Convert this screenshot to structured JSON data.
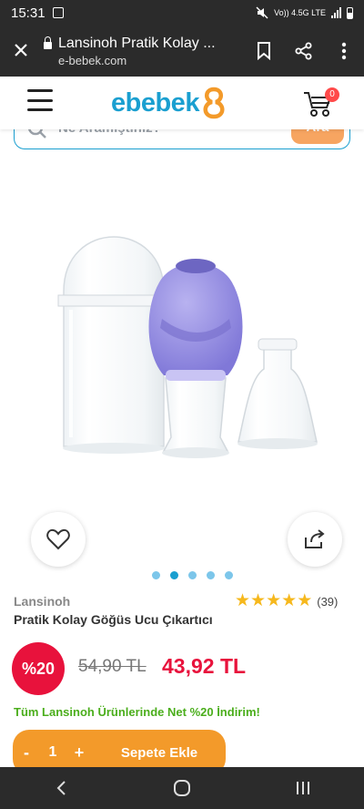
{
  "status_bar": {
    "time": "15:31",
    "network": "Vo)) 4.5G LTE"
  },
  "browser": {
    "tab_title": "Lansinoh Pratik Kolay ...",
    "domain": "e-bebek.com"
  },
  "site": {
    "logo_text": "ebebek",
    "cart_count": "0"
  },
  "search": {
    "placeholder": "Ne Aramıştınız?",
    "button": "Ara"
  },
  "product": {
    "brand": "Lansinoh",
    "name": "Pratik Kolay Göğüs Ucu Çıkartıcı",
    "rating_stars": 5,
    "rating_count": "(39)",
    "discount": "%20",
    "old_price": "54,90 TL",
    "new_price": "43,92 TL",
    "promo": "Tüm Lansinoh Ürünlerinde Net %20 İndirim!",
    "images_total": 5,
    "image_active_index": 2
  },
  "cart_bar": {
    "minus": "-",
    "quantity": "1",
    "plus": "+",
    "add_label": "Sepete Ekle"
  },
  "colors": {
    "brand_blue": "#1a9fd0",
    "accent_orange": "#f39a2a",
    "price_red": "#e8123c",
    "promo_green": "#4bae1c",
    "star": "#f6b81d"
  }
}
